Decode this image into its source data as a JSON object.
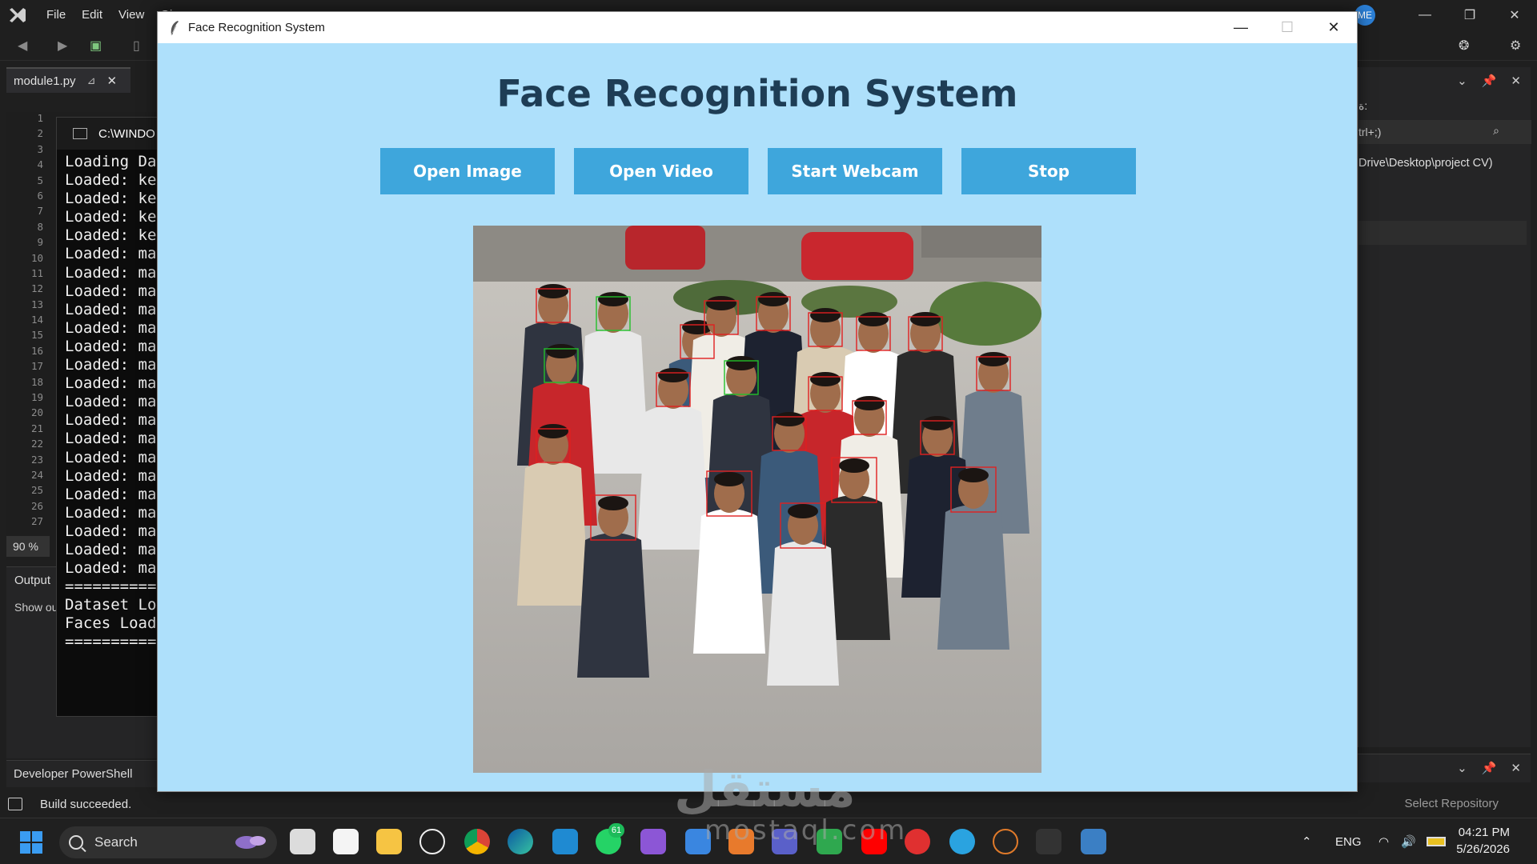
{
  "ide": {
    "menu": [
      "File",
      "Edit",
      "View",
      "Gi"
    ],
    "avatar_initials": "ME",
    "doc_tab": "module1.py",
    "line_numbers": [
      "1",
      "2",
      "3",
      "4",
      "5",
      "6",
      "7",
      "8",
      "9",
      "10",
      "11",
      "12",
      "13",
      "14",
      "15",
      "16",
      "17",
      "18",
      "19",
      "20",
      "21",
      "22",
      "23",
      "24",
      "25",
      "26",
      "27"
    ],
    "zoom": "90 %",
    "output_tab": "Output",
    "output_show": "Show ou",
    "dev_powershell": "Developer PowerShell",
    "status": "Build succeeded.",
    "select_repository": "Select Repository",
    "right_panel": {
      "search_hint": "trl+;)",
      "path": "Drive\\Desktop\\project CV)",
      "arabic_label": "ة:"
    }
  },
  "console": {
    "title": "C:\\WINDO",
    "lines": [
      "Loading Da",
      "Loaded: ke",
      "Loaded: ke",
      "Loaded: ke",
      "Loaded: ke",
      "Loaded: ma",
      "Loaded: ma",
      "Loaded: ma",
      "Loaded: ma",
      "Loaded: ma",
      "Loaded: ma",
      "Loaded: ma",
      "Loaded: ma",
      "Loaded: ma",
      "Loaded: ma",
      "Loaded: ma",
      "Loaded: ma",
      "Loaded: ma",
      "Loaded: ma",
      "Loaded: ma",
      "Loaded: ma",
      "Loaded: ma",
      "Loaded: ma",
      "==========",
      "Dataset Lo",
      "Faces Load",
      "=========="
    ]
  },
  "app": {
    "window_title": "Face Recognition System",
    "heading": "Face Recognition System",
    "buttons": {
      "open_image": "Open Image",
      "open_video": "Open Video",
      "start_webcam": "Start Webcam",
      "stop": "Stop"
    },
    "colors": {
      "background": "#aee0fb",
      "button": "#3ea6dc",
      "heading": "#1e3d55",
      "face_box_unknown": "#e02020",
      "face_box_known": "#22c02a"
    },
    "photo_icon": "group-photo-with-face-detections"
  },
  "taskbar": {
    "search_placeholder": "Search",
    "whatsapp_badge": "61",
    "language": "ENG",
    "time": "04:21 PM",
    "date": "5/26/2026"
  },
  "watermark": {
    "arabic": "مستقل",
    "latin": "mostaql.com"
  }
}
